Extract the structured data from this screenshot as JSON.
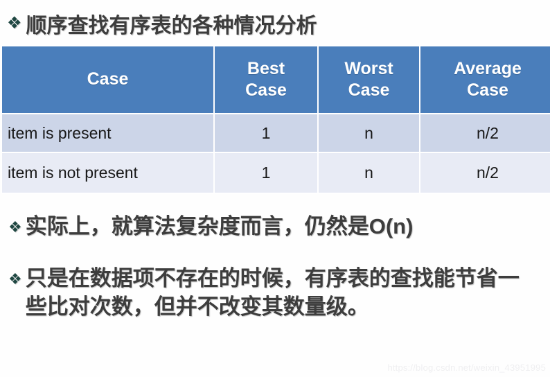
{
  "slide": {
    "title": "顺序查找有序表的各种情况分析",
    "bullet_glyph": "❖",
    "bullet_color": "#1f4742",
    "header_color": "#4a7ebb",
    "row_color_a": "#ccd5e8",
    "row_color_b": "#e8ebf5",
    "text_color": "#3d3d3d"
  },
  "table": {
    "headers": [
      "Case",
      "Best\nCase",
      "Worst\nCase",
      "Average\nCase"
    ],
    "header_case": "Case",
    "header_best_line1": "Best",
    "header_best_line2": "Case",
    "header_worst_line1": "Worst",
    "header_worst_line2": "Case",
    "header_average_line1": "Average",
    "header_average_line2": "Case",
    "rows": [
      {
        "label": "item is present",
        "best": "1",
        "worst": "n",
        "average": "n/2"
      },
      {
        "label": "item is not present",
        "best": "1",
        "worst": "n",
        "average": "n/2"
      }
    ]
  },
  "bullets": [
    {
      "text": "实际上，就算法复杂度而言，仍然是O(n)"
    },
    {
      "text": "只是在数据项不存在的时候，有序表的查找能节省一些比对次数，但并不改变其数量级。"
    }
  ],
  "watermark": {
    "text": "https://blog.csdn.net/weixin_43951995"
  }
}
